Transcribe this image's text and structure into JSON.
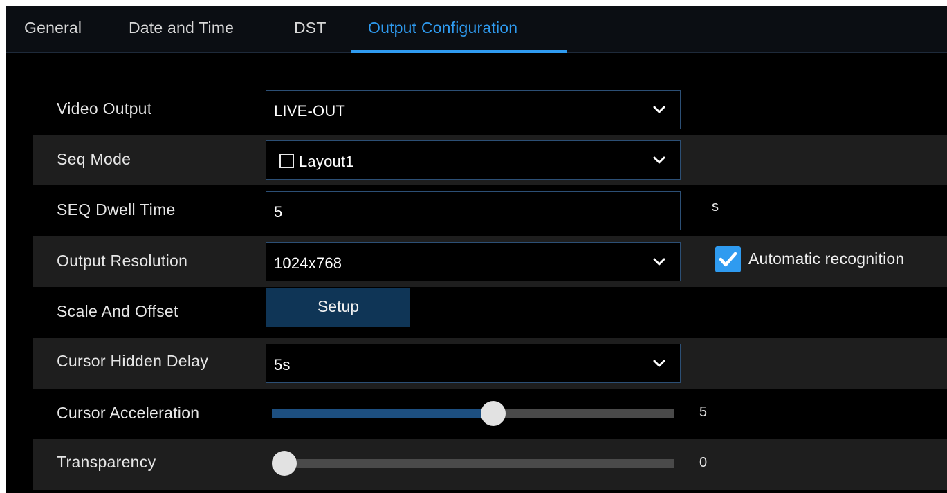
{
  "tabs": [
    {
      "label": "General",
      "active": false
    },
    {
      "label": "Date and Time",
      "active": false
    },
    {
      "label": "DST",
      "active": false
    },
    {
      "label": "Output Configuration",
      "active": true
    }
  ],
  "accent_color": "#2f9bf0",
  "settings": {
    "video_output": {
      "label": "Video Output",
      "value": "LIVE-OUT"
    },
    "seq_mode": {
      "label": "Seq Mode",
      "value": "Layout1",
      "checked": false
    },
    "seq_dwell_time": {
      "label": "SEQ Dwell Time",
      "value": "5",
      "unit": "s"
    },
    "output_resolution": {
      "label": "Output Resolution",
      "value": "1024x768",
      "auto_label": "Automatic recognition",
      "auto_checked": true
    },
    "scale_and_offset": {
      "label": "Scale And Offset",
      "button": "Setup"
    },
    "cursor_hidden_delay": {
      "label": "Cursor Hidden Delay",
      "value": "5s"
    },
    "cursor_acceleration": {
      "label": "Cursor Acceleration",
      "value": "5",
      "level": 0.55
    },
    "transparency": {
      "label": "Transparency",
      "value": "0",
      "level": 0
    }
  }
}
